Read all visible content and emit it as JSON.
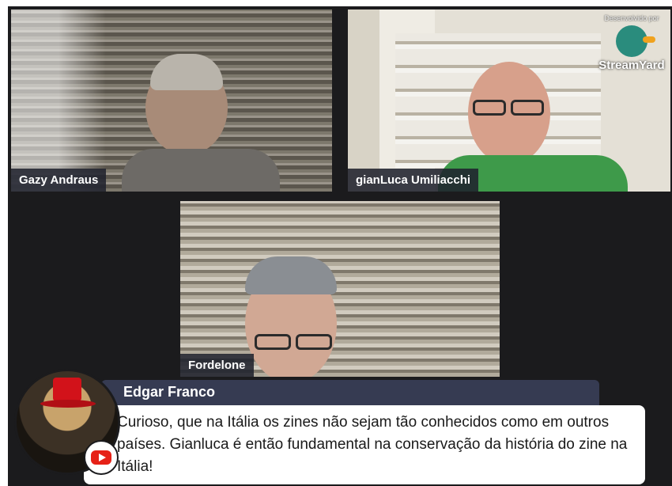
{
  "participants": [
    {
      "name": "Gazy Andraus"
    },
    {
      "name": "gianLuca Umiliacchi"
    },
    {
      "name": "Fordelone"
    }
  ],
  "brand": {
    "developed_by": "Desenvolvido por",
    "wordmark": "StreamYard",
    "icon": "streamyard-duck-icon"
  },
  "comment": {
    "author": "Edgar Franco",
    "text": "Curioso, que na Itália os zines não sejam tão conhecidos como em outros países. Gianluca é então fundamental na conservação da história do zine na Itália!",
    "platform_icon": "youtube-icon"
  },
  "colors": {
    "stage_bg": "#1b1b1d",
    "name_tag_bg": "#20222d",
    "author_bar_bg": "#363b52",
    "youtube_red": "#e62117"
  }
}
